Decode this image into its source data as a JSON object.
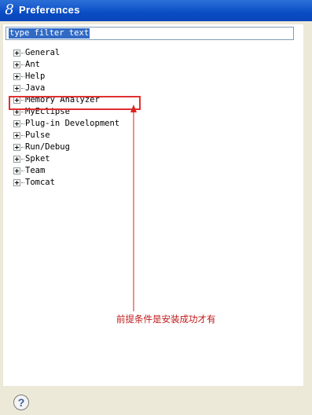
{
  "window": {
    "title": "Preferences",
    "icon": "eclipse-8-icon"
  },
  "filter": {
    "value": "type filter text"
  },
  "tree": {
    "items": [
      {
        "label": "General"
      },
      {
        "label": "Ant"
      },
      {
        "label": "Help"
      },
      {
        "label": "Java"
      },
      {
        "label": "Memory Analyzer",
        "highlighted": true
      },
      {
        "label": "MyEclipse"
      },
      {
        "label": "Plug-in Development"
      },
      {
        "label": "Pulse"
      },
      {
        "label": "Run/Debug"
      },
      {
        "label": "Spket"
      },
      {
        "label": "Team"
      },
      {
        "label": "Tomcat"
      }
    ]
  },
  "annotation": {
    "text": "前提条件是安装成功才有",
    "color": "#c01818"
  },
  "help": {
    "glyph": "?"
  }
}
